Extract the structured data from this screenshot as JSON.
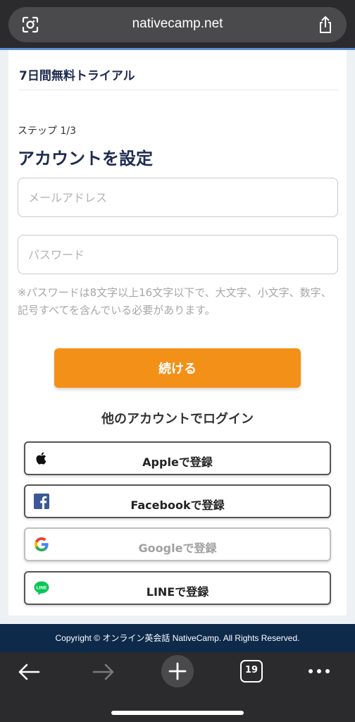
{
  "browser": {
    "url": "nativecamp.net",
    "tab_count": "19"
  },
  "page": {
    "trial_title": "7日間無料トライアル",
    "step_label": "ステップ 1/3",
    "title": "アカウントを設定",
    "email_placeholder": "メールアドレス",
    "password_placeholder": "パスワード",
    "password_note": "※パスワードは8文字以上16文字以下で、大文字、小文字、数字、記号すべてを含んでいる必要があります。",
    "continue_label": "続ける",
    "other_login_label": "他のアカウントでログイン",
    "social_buttons": [
      {
        "label": "Appleで登録",
        "icon": "apple-icon"
      },
      {
        "label": "Facebookで登録",
        "icon": "facebook-icon"
      },
      {
        "label": "Googleで登録",
        "icon": "google-icon"
      },
      {
        "label": "LINEで登録",
        "icon": "line-icon"
      }
    ]
  },
  "footer": {
    "copyright": "Copyright © オンライン英会話 NativeCamp. All Rights Reserved."
  },
  "colors": {
    "accent": "#f39018",
    "navy": "#1d2b4f",
    "footer_bg": "#0d2a4b",
    "facebook": "#3b5998",
    "line": "#06c755"
  }
}
